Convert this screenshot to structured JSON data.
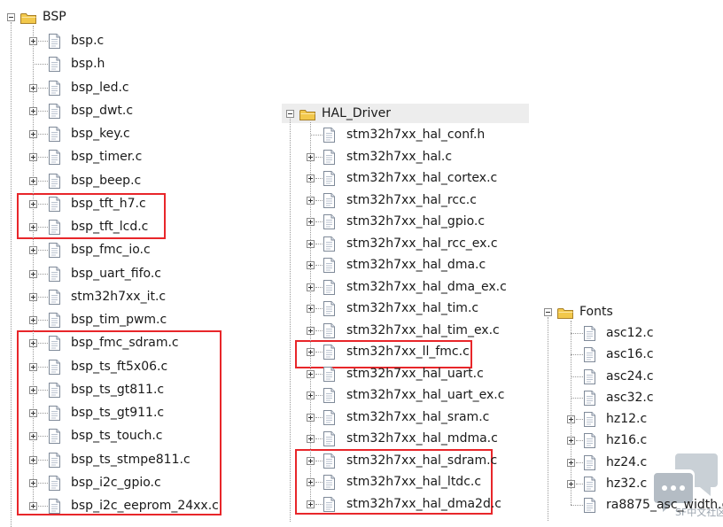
{
  "bsp": {
    "folder": "BSP",
    "files": [
      {
        "name": "bsp.c",
        "expandable": true
      },
      {
        "name": "bsp.h",
        "expandable": false
      },
      {
        "name": "bsp_led.c",
        "expandable": true
      },
      {
        "name": "bsp_dwt.c",
        "expandable": true
      },
      {
        "name": "bsp_key.c",
        "expandable": true
      },
      {
        "name": "bsp_timer.c",
        "expandable": true
      },
      {
        "name": "bsp_beep.c",
        "expandable": true
      },
      {
        "name": "bsp_tft_h7.c",
        "expandable": true
      },
      {
        "name": "bsp_tft_lcd.c",
        "expandable": true
      },
      {
        "name": "bsp_fmc_io.c",
        "expandable": true
      },
      {
        "name": "bsp_uart_fifo.c",
        "expandable": true
      },
      {
        "name": "stm32h7xx_it.c",
        "expandable": true
      },
      {
        "name": "bsp_tim_pwm.c",
        "expandable": true
      },
      {
        "name": "bsp_fmc_sdram.c",
        "expandable": true
      },
      {
        "name": "bsp_ts_ft5x06.c",
        "expandable": true
      },
      {
        "name": "bsp_ts_gt811.c",
        "expandable": true
      },
      {
        "name": "bsp_ts_gt911.c",
        "expandable": true
      },
      {
        "name": "bsp_ts_touch.c",
        "expandable": true
      },
      {
        "name": "bsp_ts_stmpe811.c",
        "expandable": true
      },
      {
        "name": "bsp_i2c_gpio.c",
        "expandable": true
      },
      {
        "name": "bsp_i2c_eeprom_24xx.c",
        "expandable": true
      }
    ]
  },
  "hal": {
    "folder": "HAL_Driver",
    "files": [
      {
        "name": "stm32h7xx_hal_conf.h",
        "expandable": false
      },
      {
        "name": "stm32h7xx_hal.c",
        "expandable": true
      },
      {
        "name": "stm32h7xx_hal_cortex.c",
        "expandable": true
      },
      {
        "name": "stm32h7xx_hal_rcc.c",
        "expandable": true
      },
      {
        "name": "stm32h7xx_hal_gpio.c",
        "expandable": true
      },
      {
        "name": "stm32h7xx_hal_rcc_ex.c",
        "expandable": true
      },
      {
        "name": "stm32h7xx_hal_dma.c",
        "expandable": true
      },
      {
        "name": "stm32h7xx_hal_dma_ex.c",
        "expandable": true
      },
      {
        "name": "stm32h7xx_hal_tim.c",
        "expandable": true
      },
      {
        "name": "stm32h7xx_hal_tim_ex.c",
        "expandable": true
      },
      {
        "name": "stm32h7xx_ll_fmc.c",
        "expandable": true
      },
      {
        "name": "stm32h7xx_hal_uart.c",
        "expandable": true
      },
      {
        "name": "stm32h7xx_hal_uart_ex.c",
        "expandable": true
      },
      {
        "name": "stm32h7xx_hal_sram.c",
        "expandable": true
      },
      {
        "name": "stm32h7xx_hal_mdma.c",
        "expandable": true
      },
      {
        "name": "stm32h7xx_hal_sdram.c",
        "expandable": true
      },
      {
        "name": "stm32h7xx_hal_ltdc.c",
        "expandable": true
      },
      {
        "name": "stm32h7xx_hal_dma2d.c",
        "expandable": true
      }
    ]
  },
  "fonts": {
    "folder": "Fonts",
    "files": [
      {
        "name": "asc12.c",
        "expandable": false
      },
      {
        "name": "asc16.c",
        "expandable": false
      },
      {
        "name": "asc24.c",
        "expandable": false
      },
      {
        "name": "asc32.c",
        "expandable": false
      },
      {
        "name": "hz12.c",
        "expandable": true
      },
      {
        "name": "hz16.c",
        "expandable": true
      },
      {
        "name": "hz24.c",
        "expandable": true
      },
      {
        "name": "hz32.c",
        "expandable": true
      },
      {
        "name": "ra8875_asc_width.c",
        "expandable": false
      }
    ]
  },
  "watermark": {
    "text": "SF中文社区"
  },
  "colors": {
    "highlight_box": "#e8262a",
    "folder_yellow": "#f2c84b",
    "tree_line": "#9a9a9a"
  }
}
